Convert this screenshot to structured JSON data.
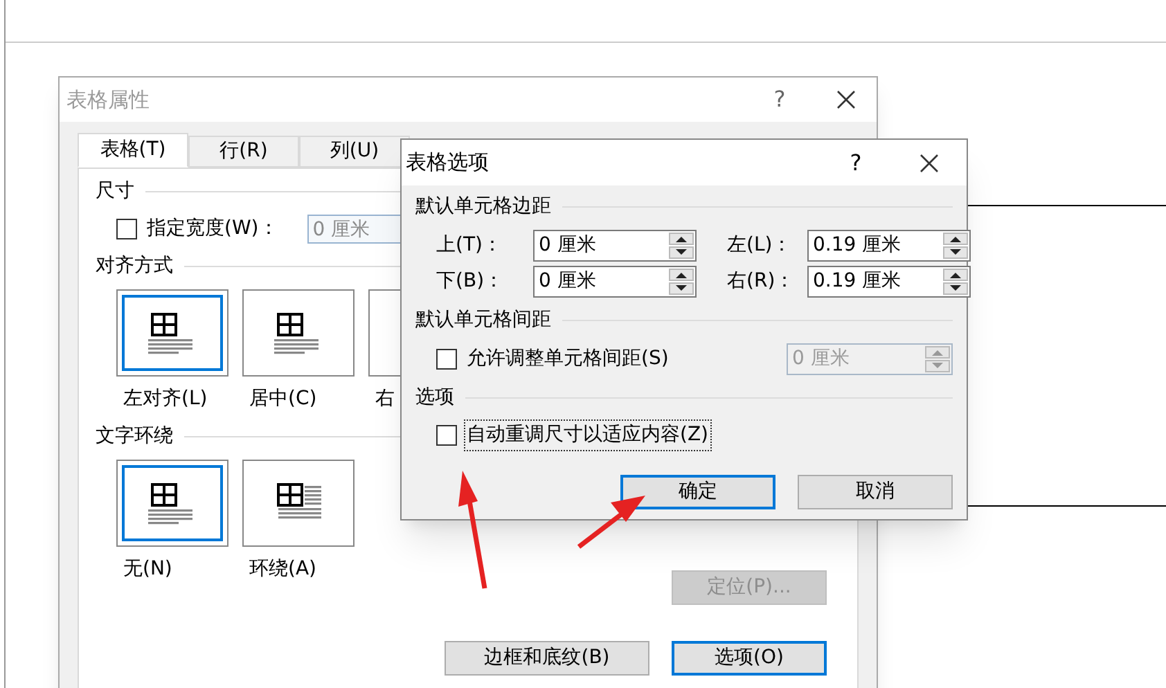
{
  "table_properties": {
    "title": "表格属性",
    "help": "?",
    "tabs": [
      {
        "label": "表格(T)",
        "selected": true
      },
      {
        "label": "行(R)",
        "selected": false
      },
      {
        "label": "列(U)",
        "selected": false
      }
    ],
    "size": {
      "heading": "尺寸",
      "width_checkbox": {
        "label": "指定宽度(W)：",
        "checked": false
      },
      "width_field": {
        "value": "0 厘米",
        "disabled": true
      }
    },
    "alignment": {
      "heading": "对齐方式",
      "options": [
        {
          "label": "左对齐(L)",
          "selected": true
        },
        {
          "label": "居中(C)",
          "selected": false
        },
        {
          "label": "右",
          "selected": false
        }
      ]
    },
    "wrapping": {
      "heading": "文字环绕",
      "options": [
        {
          "label": "无(N)",
          "selected": true,
          "kind": "plain"
        },
        {
          "label": "环绕(A)",
          "selected": false,
          "kind": "around"
        }
      ]
    },
    "position_button": {
      "label": "定位(P)...",
      "disabled": true
    },
    "buttons": [
      {
        "label": "边框和底纹(B)",
        "default": false
      },
      {
        "label": "选项(O)",
        "default": true
      }
    ]
  },
  "table_options": {
    "title": "表格选项",
    "help": "?",
    "margins": {
      "heading": "默认单元格边距",
      "fields": [
        {
          "label": "上(T)：",
          "value": "0 厘米"
        },
        {
          "label": "左(L)：",
          "value": "0.19 厘米"
        },
        {
          "label": "下(B)：",
          "value": "0 厘米"
        },
        {
          "label": "右(R)：",
          "value": "0.19 厘米"
        }
      ]
    },
    "spacing": {
      "heading": "默认单元格间距",
      "checkbox": {
        "label": "允许调整单元格间距(S)",
        "checked": false
      },
      "field": {
        "value": "0 厘米",
        "disabled": true
      }
    },
    "options": {
      "heading": "选项",
      "checkbox": {
        "label": "自动重调尺寸以适应内容(Z)",
        "checked": false,
        "focused": true
      }
    },
    "buttons": [
      {
        "label": "确定",
        "default": true
      },
      {
        "label": "取消",
        "default": false
      }
    ]
  }
}
